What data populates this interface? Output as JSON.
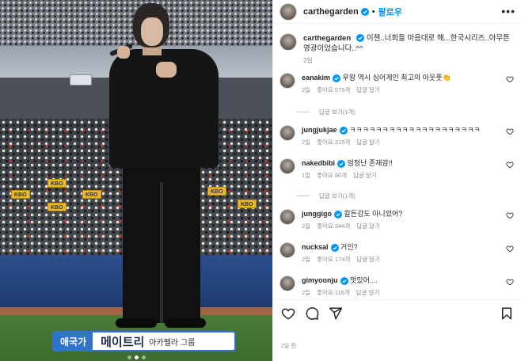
{
  "photo": {
    "caption_tag": "애국가",
    "caption_name": "메이트리",
    "caption_sub": "아카펠라 그룹",
    "sign_text": "KBO",
    "carousel_dots": 3,
    "active_dot": 2
  },
  "header": {
    "username": "carthegarden",
    "bullet": "•",
    "follow_label": "팔로우",
    "more_label": "•••"
  },
  "post_caption": {
    "username": "carthegarden",
    "text": "이젠..너희들 마음대로 해...한국시리즈..아무튼 영광이었습니다..^^",
    "time": "2일"
  },
  "comments": [
    {
      "username": "eanakim",
      "verified": true,
      "text": "우왕 역시 싱어게인 최고의 아웃풋👏",
      "time": "2일",
      "likes": "좋아요 579개",
      "reply": "답글 달기",
      "view_replies": "답글 보기(1개)"
    },
    {
      "username": "jungjukjae",
      "verified": true,
      "text": "ㅋㅋㅋㅋㅋㅋㅋㅋㅋㅋㅋㅋㅋㅋㅋㅋㅋㅋㅋㅋ",
      "time": "2일",
      "likes": "좋아요 315개",
      "reply": "답글 달기",
      "view_replies": ""
    },
    {
      "username": "nakedbibi",
      "verified": true,
      "text": "엄청난 존재감!!",
      "time": "1일",
      "likes": "좋아요 80개",
      "reply": "답글 달기",
      "view_replies": "답글 보기(1개)"
    },
    {
      "username": "junggigo",
      "verified": true,
      "text": "칼든강도 아니었어?",
      "time": "2일",
      "likes": "좋아요 344개",
      "reply": "답글 달기",
      "view_replies": ""
    },
    {
      "username": "nucksal",
      "verified": true,
      "text": "거인?",
      "time": "2일",
      "likes": "좋아요 174개",
      "reply": "답글 달기",
      "view_replies": ""
    },
    {
      "username": "gimyoonju",
      "verified": true,
      "text": "멋있어....",
      "time": "2일",
      "likes": "좋아요 116개",
      "reply": "답글 달기",
      "view_replies": ""
    }
  ],
  "footer": {
    "date": "2일 전"
  },
  "colors": {
    "accent": "#0095f6",
    "verified": "#0095f6",
    "caption_blue": "#2f74c9"
  },
  "icons": [
    "more-icon",
    "heart-icon",
    "comment-icon",
    "share-icon",
    "bookmark-icon",
    "verified-icon"
  ]
}
